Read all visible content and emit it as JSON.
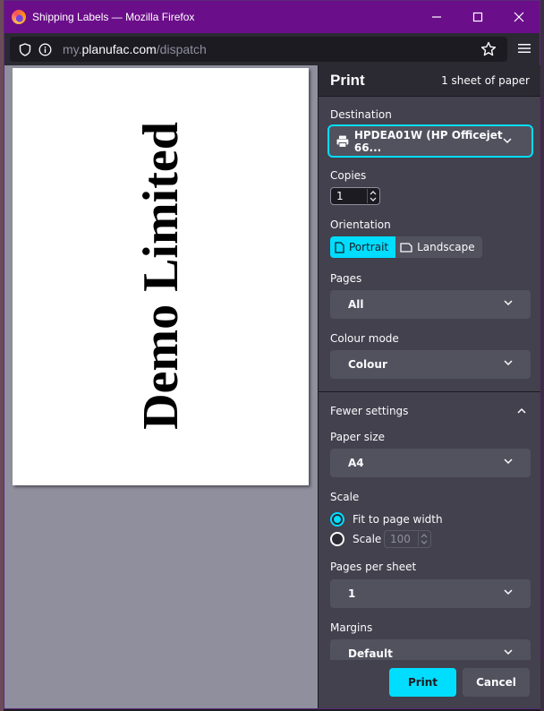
{
  "window": {
    "title": "Shipping Labels — Mozilla Firefox"
  },
  "navbar": {
    "url_prefix": "my.",
    "url_host": "planufac.com",
    "url_path": "/dispatch"
  },
  "preview": {
    "page_text": "Demo Limited"
  },
  "print": {
    "title": "Print",
    "sheets": "1 sheet of paper",
    "destination": {
      "label": "Destination",
      "value": "HPDEA01W (HP Officejet 66..."
    },
    "copies": {
      "label": "Copies",
      "value": "1"
    },
    "orientation": {
      "label": "Orientation",
      "options": [
        "Portrait",
        "Landscape"
      ],
      "selected": "Portrait"
    },
    "pages": {
      "label": "Pages",
      "value": "All"
    },
    "colour_mode": {
      "label": "Colour mode",
      "value": "Colour"
    },
    "fewer_settings": "Fewer settings",
    "paper_size": {
      "label": "Paper size",
      "value": "A4"
    },
    "scale": {
      "label": "Scale",
      "fit_label": "Fit to page width",
      "scale_label": "Scale",
      "scale_value": "100",
      "selected": "fit"
    },
    "pages_per_sheet": {
      "label": "Pages per sheet",
      "value": "1"
    },
    "margins": {
      "label": "Margins",
      "value": "Default"
    },
    "print_button": "Print",
    "cancel_button": "Cancel"
  },
  "colors": {
    "titlebar": "#6b0e8a",
    "accent": "#00ddff",
    "sidebar": "#42414d",
    "preview_bg": "#8f8f9d"
  }
}
